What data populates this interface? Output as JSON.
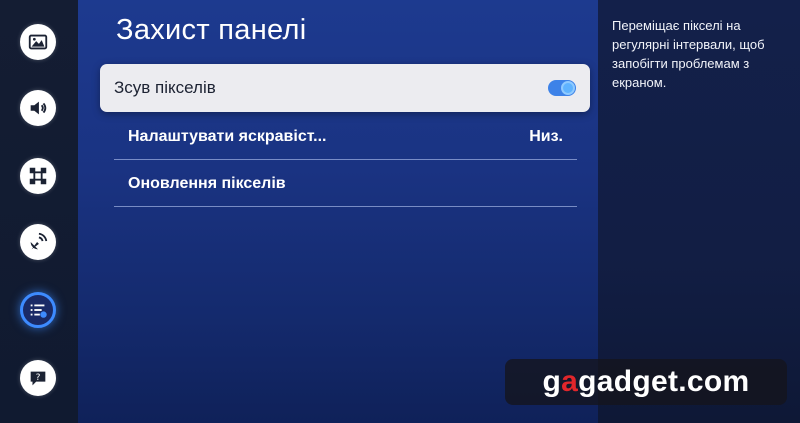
{
  "page": {
    "title": "Захист панелі"
  },
  "sidebar": {
    "items": [
      {
        "icon": "picture-icon",
        "active": false
      },
      {
        "icon": "sound-icon",
        "active": false
      },
      {
        "icon": "connection-icon",
        "active": false
      },
      {
        "icon": "broadcast-icon",
        "active": false
      },
      {
        "icon": "general-settings-icon",
        "active": true
      },
      {
        "icon": "support-icon",
        "active": false
      }
    ]
  },
  "menu": {
    "items": [
      {
        "label": "Зсув пікселів",
        "type": "toggle",
        "on": true,
        "focused": true
      },
      {
        "label": "Налаштувати яскравіст...",
        "value": "Низ."
      },
      {
        "label": "Оновлення пікселів"
      }
    ]
  },
  "description": {
    "text": "Переміщає пікселі на регулярні інтервали, щоб запобігти проблемам з екраном."
  },
  "watermark": {
    "part1": "g",
    "part2": "a",
    "part3": "g",
    "part4": "adget.com"
  },
  "colors": {
    "accent": "#3d82e8",
    "focused_row_bg": "#ececf0",
    "panel_bg": "#1d3a8f",
    "watermark_red": "#e2262b"
  }
}
